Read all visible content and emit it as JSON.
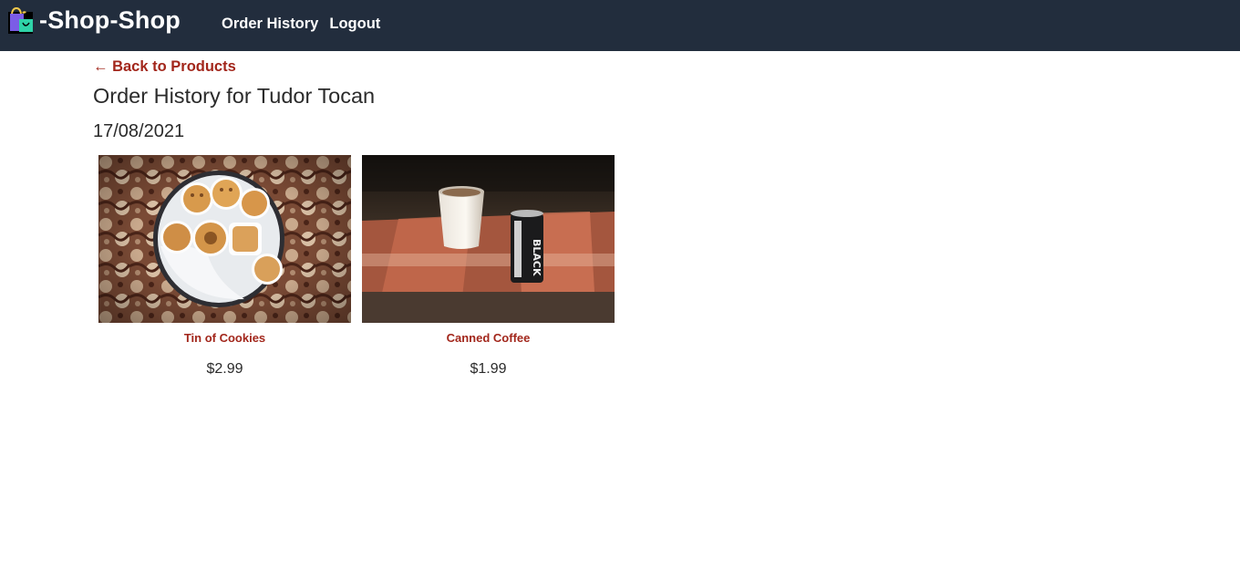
{
  "navbar": {
    "brand_icon": "shopping-bags-icon",
    "brand_text": "-Shop-Shop",
    "links": {
      "order_history": "Order History",
      "logout": "Logout"
    },
    "background_color": "#222d3d"
  },
  "main": {
    "back_link": "← Back to Products",
    "title": "Order History for Tudor Tocan",
    "orders": [
      {
        "date": "17/08/2021",
        "products": [
          {
            "name": "Tin of Cookies",
            "price": "$2.99",
            "image": "tin-of-cookies-photo"
          },
          {
            "name": "Canned Coffee",
            "price": "$1.99",
            "image": "canned-coffee-photo"
          }
        ]
      }
    ]
  },
  "colors": {
    "accent": "#a2261b",
    "text": "#2b2b2b"
  }
}
